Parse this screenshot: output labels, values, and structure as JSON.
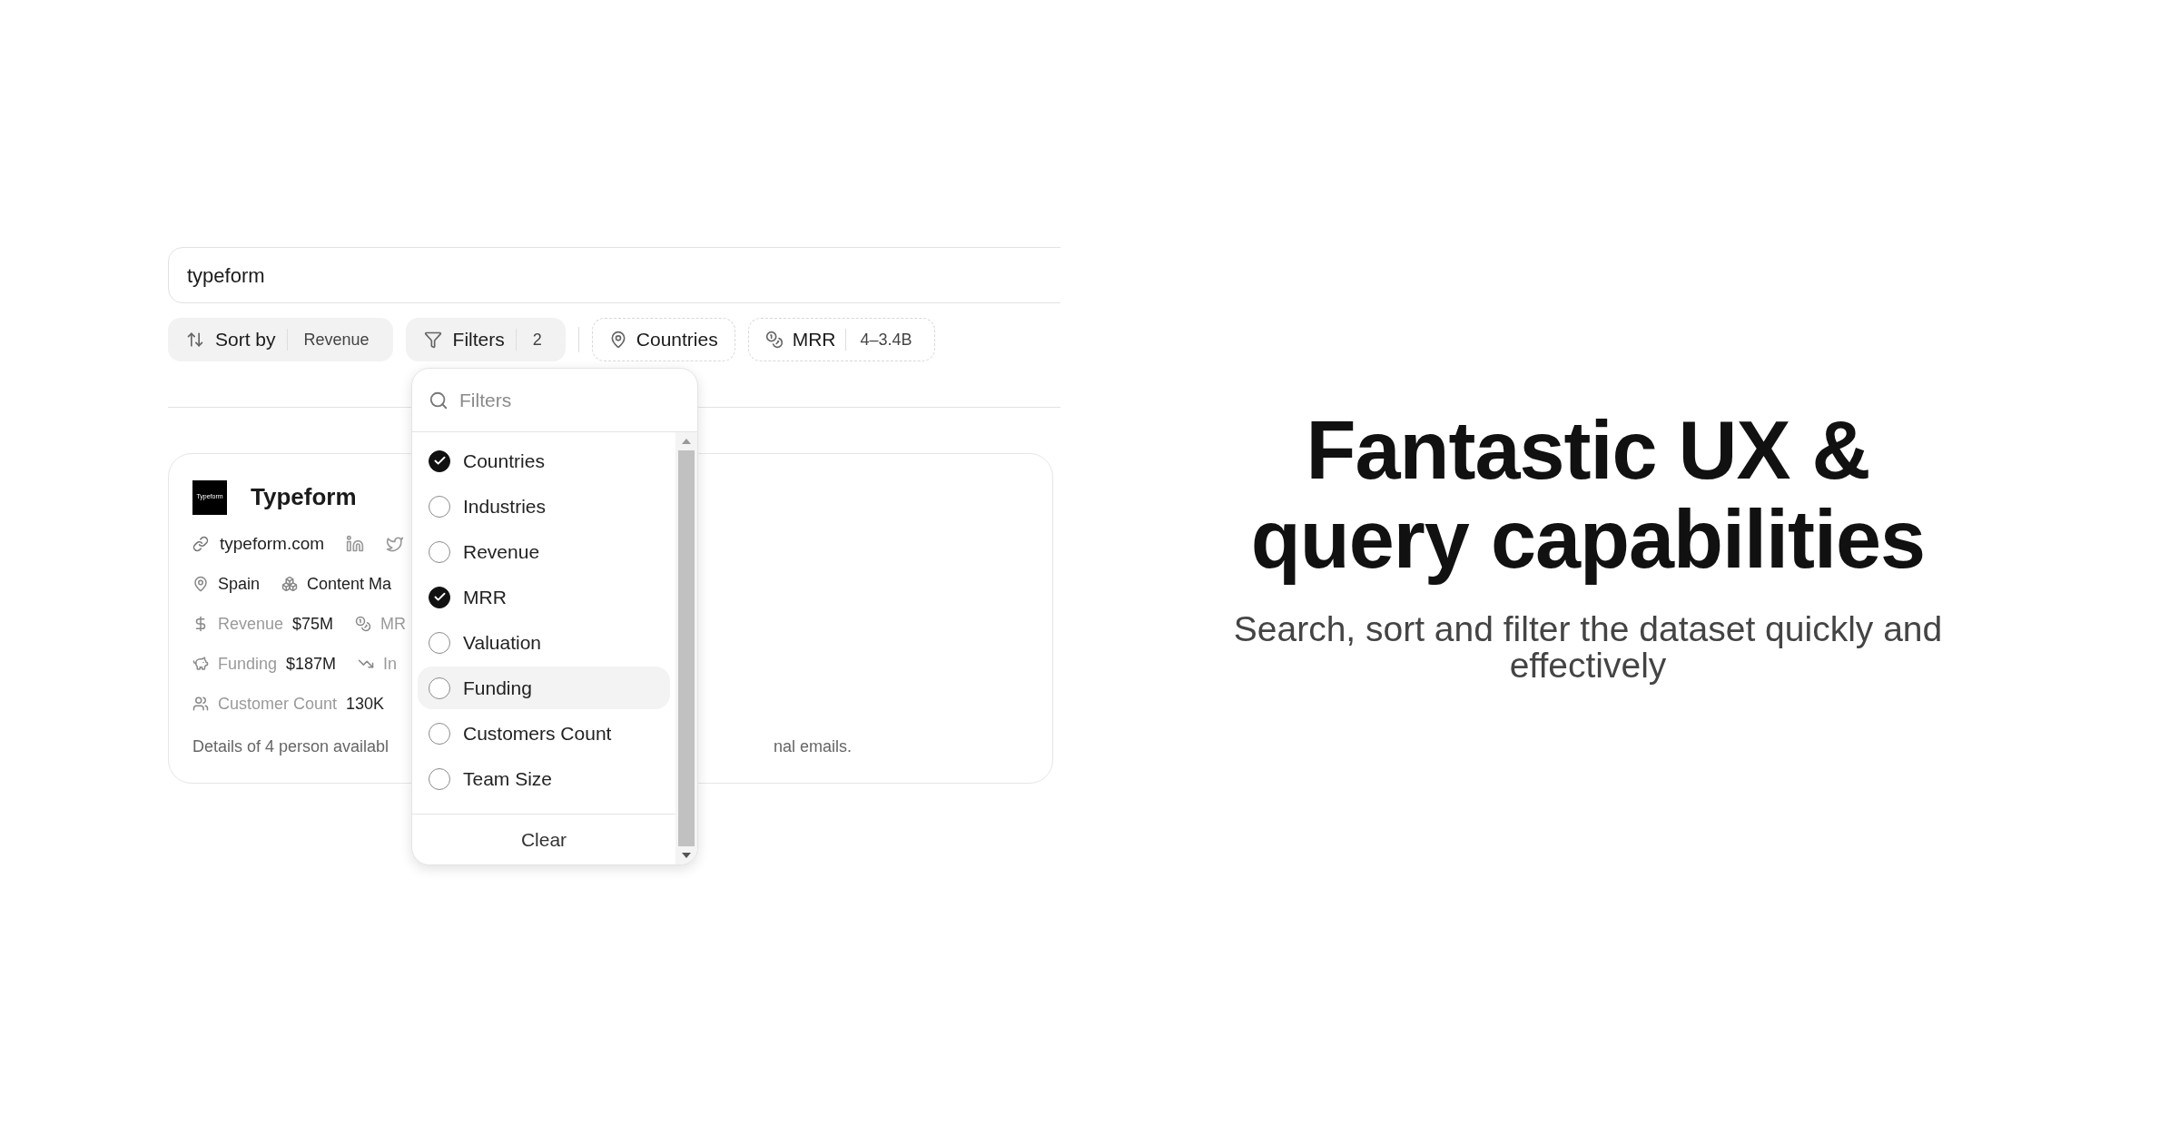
{
  "search": {
    "value": "typeform"
  },
  "toolbar": {
    "sort": {
      "label": "Sort by",
      "value": "Revenue"
    },
    "filters": {
      "label": "Filters",
      "count": "2"
    },
    "active_filters": [
      {
        "kind": "country",
        "label": "Countries"
      },
      {
        "kind": "mrr",
        "label": "MRR",
        "value": "4–3.4B"
      }
    ]
  },
  "card": {
    "logo_text": "Typeform",
    "name": "Typeform",
    "website": "typeform.com",
    "rows": [
      [
        {
          "kind": "location",
          "value": "Spain"
        },
        {
          "kind": "industry",
          "value": "Content Ma"
        }
      ],
      [
        {
          "kind": "revenue",
          "label": "Revenue",
          "value": "$75M"
        },
        {
          "kind": "mrr",
          "label": "MR"
        }
      ],
      [
        {
          "kind": "funding",
          "label": "Funding",
          "value": "$187M"
        },
        {
          "kind": "trend",
          "label": "In"
        }
      ],
      [
        {
          "kind": "customers",
          "label": "Customer Count",
          "value": "130K"
        }
      ]
    ],
    "footer_left": "Details of 4 person availabl",
    "footer_right": "nal emails."
  },
  "filter_menu": {
    "placeholder": "Filters",
    "options": [
      {
        "label": "Countries",
        "checked": true,
        "highlighted": false
      },
      {
        "label": "Industries",
        "checked": false,
        "highlighted": false
      },
      {
        "label": "Revenue",
        "checked": false,
        "highlighted": false
      },
      {
        "label": "MRR",
        "checked": true,
        "highlighted": false
      },
      {
        "label": "Valuation",
        "checked": false,
        "highlighted": false
      },
      {
        "label": "Funding",
        "checked": false,
        "highlighted": true
      },
      {
        "label": "Customers Count",
        "checked": false,
        "highlighted": false
      },
      {
        "label": "Team Size",
        "checked": false,
        "highlighted": false
      }
    ],
    "clear": "Clear"
  },
  "hero": {
    "title_lines": [
      "Fantastic UX &",
      "query capabilities"
    ],
    "subtitle_lines": [
      "Search, sort and filter the dataset quickly and",
      "effectively"
    ]
  }
}
